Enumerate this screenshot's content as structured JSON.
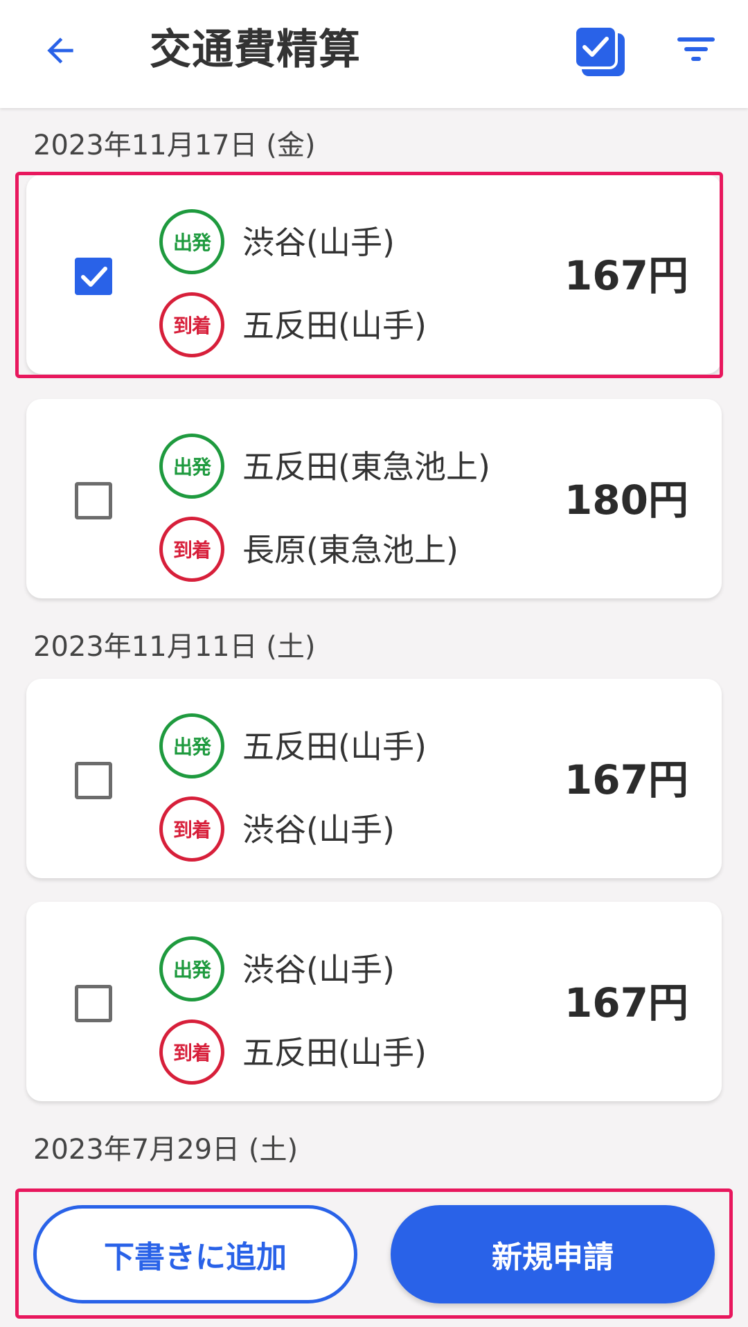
{
  "header": {
    "title": "交通費精算",
    "back_icon": "arrow-left-icon",
    "select_all_icon": "multi-checkbox-icon",
    "filter_icon": "filter-icon"
  },
  "groups": [
    {
      "date": "2023年11月17日 (金)",
      "entries": [
        {
          "checked": true,
          "departure_badge": "出発",
          "departure": "渋谷(山手)",
          "arrival_badge": "到着",
          "arrival": "五反田(山手)",
          "fare": "167円"
        },
        {
          "checked": false,
          "departure_badge": "出発",
          "departure": "五反田(東急池上)",
          "arrival_badge": "到着",
          "arrival": "長原(東急池上)",
          "fare": "180円"
        }
      ]
    },
    {
      "date": "2023年11月11日 (土)",
      "entries": [
        {
          "checked": false,
          "departure_badge": "出発",
          "departure": "五反田(山手)",
          "arrival_badge": "到着",
          "arrival": "渋谷(山手)",
          "fare": "167円"
        },
        {
          "checked": false,
          "departure_badge": "出発",
          "departure": "渋谷(山手)",
          "arrival_badge": "到着",
          "arrival": "五反田(山手)",
          "fare": "167円"
        }
      ]
    },
    {
      "date": "2023年7月29日 (土)",
      "entries": []
    }
  ],
  "footer": {
    "draft_label": "下書きに追加",
    "new_label": "新規申請"
  },
  "colors": {
    "accent": "#2962e8",
    "departure": "#1e9a3e",
    "arrival": "#d71f3a",
    "highlight": "#e8175d"
  }
}
